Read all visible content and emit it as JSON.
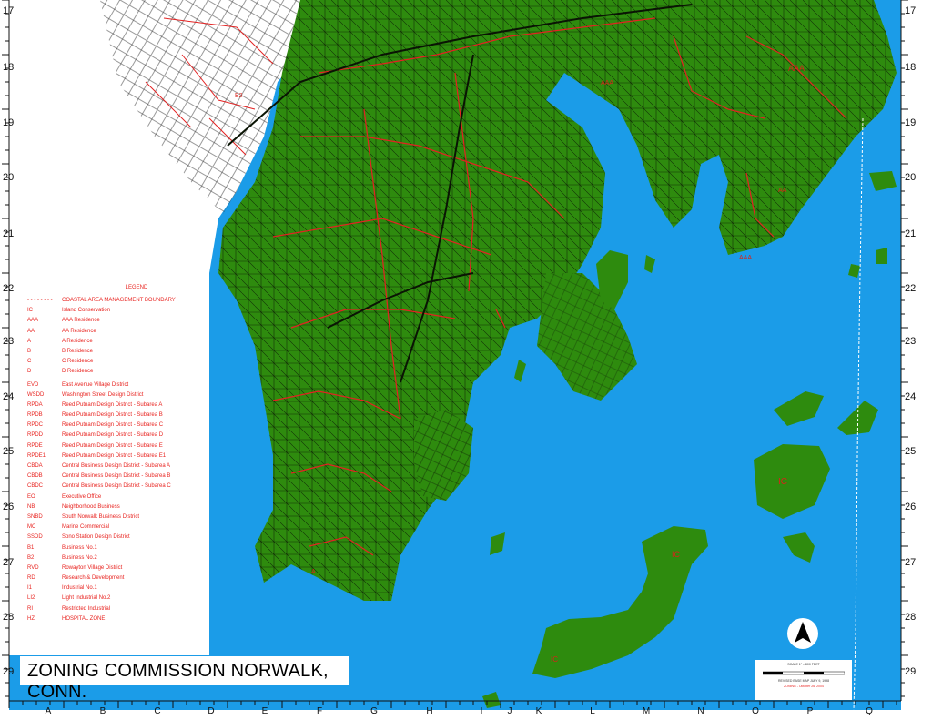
{
  "title": "ZONING COMMISSION NORWALK, CONN.",
  "grid": {
    "rows": [
      "17",
      "18",
      "19",
      "20",
      "21",
      "22",
      "23",
      "24",
      "25",
      "26",
      "27",
      "28",
      "29"
    ],
    "columns": [
      "A",
      "B",
      "C",
      "D",
      "E",
      "F",
      "G",
      "H",
      "I",
      "J",
      "K",
      "L",
      "M",
      "N",
      "O",
      "P",
      "Q"
    ]
  },
  "legend": {
    "title": "LEGEND",
    "groups": [
      [
        {
          "code": "- - - - - - - -",
          "desc": "COASTAL AREA MANAGEMENT BOUNDARY"
        },
        {
          "code": "IC",
          "desc": "Island Conservation"
        },
        {
          "code": "AAA",
          "desc": "AAA Residence"
        },
        {
          "code": "AA",
          "desc": "AA Residence"
        },
        {
          "code": "A",
          "desc": "A Residence"
        },
        {
          "code": "B",
          "desc": "B Residence"
        },
        {
          "code": "C",
          "desc": "C Residence"
        },
        {
          "code": "D",
          "desc": "D Residence"
        }
      ],
      [
        {
          "code": "EVD",
          "desc": "East Avenue Village District"
        },
        {
          "code": "WSDD",
          "desc": "Washington Street Design District"
        },
        {
          "code": "RPDA",
          "desc": "Reed Putnam Design District - Subarea A"
        },
        {
          "code": "RPDB",
          "desc": "Reed Putnam Design District - Subarea B"
        },
        {
          "code": "RPDC",
          "desc": "Reed Putnam Design District - Subarea C"
        },
        {
          "code": "RPDD",
          "desc": "Reed Putnam Design District - Subarea D"
        },
        {
          "code": "RPDE",
          "desc": "Reed Putnam Design District - Subarea E"
        },
        {
          "code": "RPDE1",
          "desc": "Reed Putnam Design District - Subarea E1"
        },
        {
          "code": "CBDA",
          "desc": "Central Business Design District - Subarea A"
        },
        {
          "code": "CBDB",
          "desc": "Central Business Design District - Subarea B"
        },
        {
          "code": "CBDC",
          "desc": "Central Business Design District - Subarea C"
        },
        {
          "code": "EO",
          "desc": "Executive Office"
        },
        {
          "code": "NB",
          "desc": "Neighborhood Business"
        },
        {
          "code": "SNBD",
          "desc": "South Norwalk Business District"
        },
        {
          "code": "MC",
          "desc": "Marine Commercial"
        },
        {
          "code": "SSDD",
          "desc": "Sono Station Design District"
        },
        {
          "code": "B1",
          "desc": "Business No.1"
        },
        {
          "code": "B2",
          "desc": "Business No.2"
        },
        {
          "code": "RVD",
          "desc": "Rowayton Village District"
        },
        {
          "code": "RD",
          "desc": "Research & Development"
        },
        {
          "code": "I1",
          "desc": "Industrial No.1"
        },
        {
          "code": "LI2",
          "desc": "Light Industrial No.2"
        },
        {
          "code": "RI",
          "desc": "Restricted Industrial"
        },
        {
          "code": "HZ",
          "desc": "HOSPITAL ZONE"
        }
      ]
    ]
  },
  "zone_labels": [
    "AAA",
    "AAA",
    "AAA",
    "IC",
    "IC",
    "IC",
    "B2",
    "A",
    "AA"
  ],
  "scale_box": {
    "scale": "SCALE 1\" = 800 FEET",
    "revised": "REVISED BASE MAP JULY 9, 1998",
    "zoning": "ZONING - October 26, 2004"
  },
  "colors": {
    "land": "#2e8b0e",
    "water": "#1b9ce8",
    "zone_line": "#e32222",
    "street_line": "#0d1f05",
    "legend_text": "#e8231f"
  },
  "icons": {
    "north_arrow": "north-arrow-icon"
  }
}
